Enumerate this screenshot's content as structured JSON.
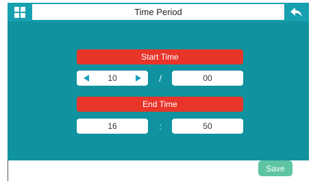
{
  "header": {
    "title": "Time Period",
    "left_icon": "grid-icon",
    "right_icon": "back-arrow-icon"
  },
  "start": {
    "label": "Start Time",
    "hour": "10",
    "separator": "/",
    "minute": "00"
  },
  "end": {
    "label": "End Time",
    "hour": "16",
    "separator": ":",
    "minute": "50"
  },
  "footer": {
    "save_label": "Save"
  },
  "colors": {
    "header": "#17a0b0",
    "panel": "#10939f",
    "bar": "#e8352a",
    "arrow": "#1a9fc0",
    "save": "#5ec4a4"
  }
}
